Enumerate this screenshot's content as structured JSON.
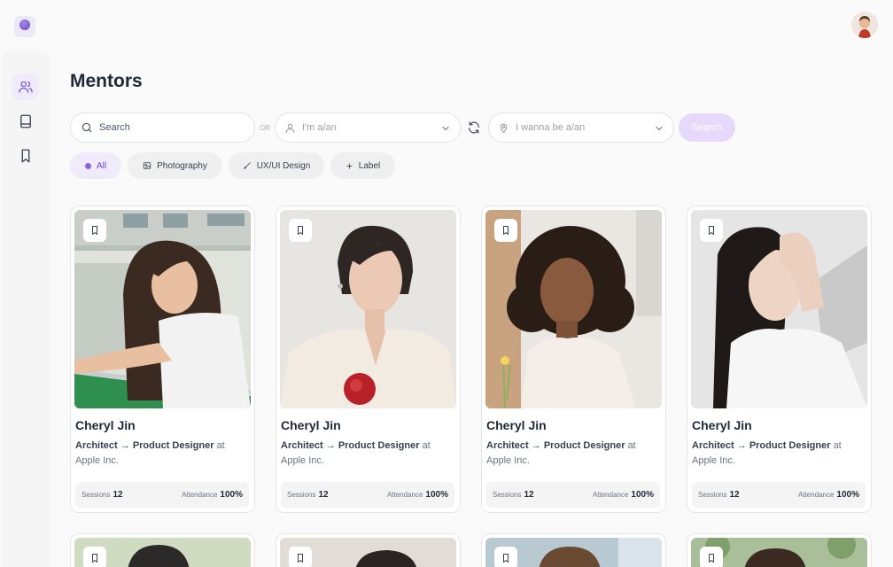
{
  "header": {
    "logo": "app-logo",
    "avatar": "user-avatar"
  },
  "sidebar": {
    "items": [
      {
        "icon": "users-icon",
        "active": true
      },
      {
        "icon": "book-icon",
        "active": false
      },
      {
        "icon": "bookmark-icon",
        "active": false
      }
    ]
  },
  "page": {
    "title": "Mentors"
  },
  "filters": {
    "search_placeholder": "Search",
    "or_label": "OR",
    "current_role_placeholder": "I'm a/an",
    "target_role_placeholder": "I wanna be a/an",
    "search_button": "Search"
  },
  "chips": [
    {
      "label": "All",
      "icon": "dot-icon",
      "active": true
    },
    {
      "label": "Photography",
      "icon": "image-icon",
      "active": false
    },
    {
      "label": "UX/UI Design",
      "icon": "brush-icon",
      "active": false
    },
    {
      "label": "Label",
      "icon": "plus-icon",
      "active": false
    }
  ],
  "mentors": [
    {
      "name": "Cheryl Jin",
      "from": "Architect",
      "to": "Product Designer",
      "at_word": "at",
      "company": "Apple Inc.",
      "sessions_label": "Sessions",
      "sessions": "12",
      "attendance_label": "Attendance",
      "attendance": "100%"
    },
    {
      "name": "Cheryl Jin",
      "from": "Architect",
      "to": "Product Designer",
      "at_word": "at",
      "company": "Apple Inc.",
      "sessions_label": "Sessions",
      "sessions": "12",
      "attendance_label": "Attendance",
      "attendance": "100%"
    },
    {
      "name": "Cheryl Jin",
      "from": "Architect",
      "to": "Product Designer",
      "at_word": "at",
      "company": "Apple Inc.",
      "sessions_label": "Sessions",
      "sessions": "12",
      "attendance_label": "Attendance",
      "attendance": "100%"
    },
    {
      "name": "Cheryl Jin",
      "from": "Architect",
      "to": "Product Designer",
      "at_word": "at",
      "company": "Apple Inc.",
      "sessions_label": "Sessions",
      "sessions": "12",
      "attendance_label": "Attendance",
      "attendance": "100%"
    }
  ],
  "colors": {
    "accent": "#8b63e0",
    "accent_soft": "#f0ebfb",
    "search_button_bg": "#e6d9fb"
  }
}
